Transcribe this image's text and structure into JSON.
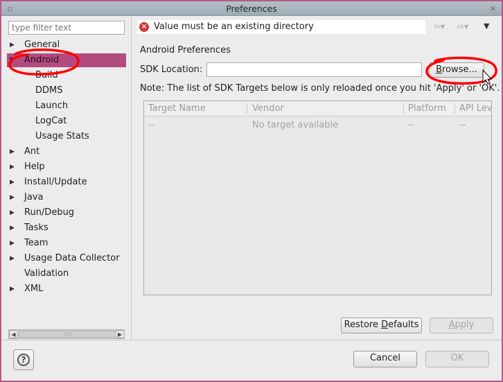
{
  "window": {
    "title": "Preferences"
  },
  "filter": {
    "placeholder": "type filter text"
  },
  "tree": [
    {
      "label": "General",
      "arrow": "▶",
      "child": false,
      "selected": false
    },
    {
      "label": "Android",
      "arrow": "▼",
      "child": false,
      "selected": true
    },
    {
      "label": "Build",
      "arrow": "",
      "child": true,
      "selected": false
    },
    {
      "label": "DDMS",
      "arrow": "",
      "child": true,
      "selected": false
    },
    {
      "label": "Launch",
      "arrow": "",
      "child": true,
      "selected": false
    },
    {
      "label": "LogCat",
      "arrow": "",
      "child": true,
      "selected": false
    },
    {
      "label": "Usage Stats",
      "arrow": "",
      "child": true,
      "selected": false
    },
    {
      "label": "Ant",
      "arrow": "▶",
      "child": false,
      "selected": false
    },
    {
      "label": "Help",
      "arrow": "▶",
      "child": false,
      "selected": false
    },
    {
      "label": "Install/Update",
      "arrow": "▶",
      "child": false,
      "selected": false
    },
    {
      "label": "Java",
      "arrow": "▶",
      "child": false,
      "selected": false
    },
    {
      "label": "Run/Debug",
      "arrow": "▶",
      "child": false,
      "selected": false
    },
    {
      "label": "Tasks",
      "arrow": "▶",
      "child": false,
      "selected": false
    },
    {
      "label": "Team",
      "arrow": "▶",
      "child": false,
      "selected": false
    },
    {
      "label": "Usage Data Collector",
      "arrow": "▶",
      "child": false,
      "selected": false
    },
    {
      "label": "Validation",
      "arrow": "",
      "child": false,
      "selected": false
    },
    {
      "label": "XML",
      "arrow": "▶",
      "child": false,
      "selected": false
    }
  ],
  "message": {
    "text": "Value must be an existing directory",
    "icon": "error-icon"
  },
  "page": {
    "title": "Android Preferences",
    "sdk_label": "SDK Location:",
    "sdk_value": "",
    "browse_pre": "B",
    "browse_u": "",
    "browse_post": "rowse...",
    "note": "Note: The list of SDK Targets below is only reloaded once you hit 'Apply' or 'OK'."
  },
  "table": {
    "headers": [
      "Target Name",
      "Vendor",
      "Platform",
      "API Lev"
    ],
    "row": [
      "--",
      "No target available",
      "--",
      "--"
    ]
  },
  "buttons": {
    "restore_pre": "Restore ",
    "restore_u": "D",
    "restore_post": "efaults",
    "apply_u": "A",
    "apply_post": "pply",
    "cancel": "Cancel",
    "ok": "OK"
  },
  "colors": {
    "accent": "#b24c7f",
    "annotation": "#ff0000"
  }
}
